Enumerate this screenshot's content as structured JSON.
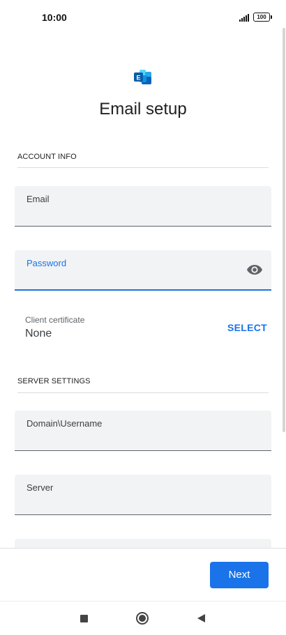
{
  "status_bar": {
    "time": "10:00",
    "battery": "100",
    "signal_icon": "signal-icon"
  },
  "header": {
    "logo_icon": "exchange-logo-icon",
    "title": "Email setup"
  },
  "account_info": {
    "header": "ACCOUNT INFO",
    "email": {
      "label": "Email",
      "value": ""
    },
    "password": {
      "label": "Password",
      "value": "",
      "toggle_icon": "eye-icon"
    },
    "client_certificate": {
      "label": "Client certificate",
      "value": "None",
      "action_label": "SELECT"
    }
  },
  "server_settings": {
    "header": "SERVER SETTINGS",
    "domain_username": {
      "label": "Domain\\Username",
      "value": ""
    },
    "server": {
      "label": "Server",
      "value": ""
    }
  },
  "footer": {
    "next_label": "Next"
  },
  "nav": {
    "recents_icon": "square-icon",
    "home_icon": "circle-icon",
    "back_icon": "triangle-back-icon"
  },
  "colors": {
    "accent": "#1a73e8",
    "field_bg": "#f1f3f4"
  }
}
